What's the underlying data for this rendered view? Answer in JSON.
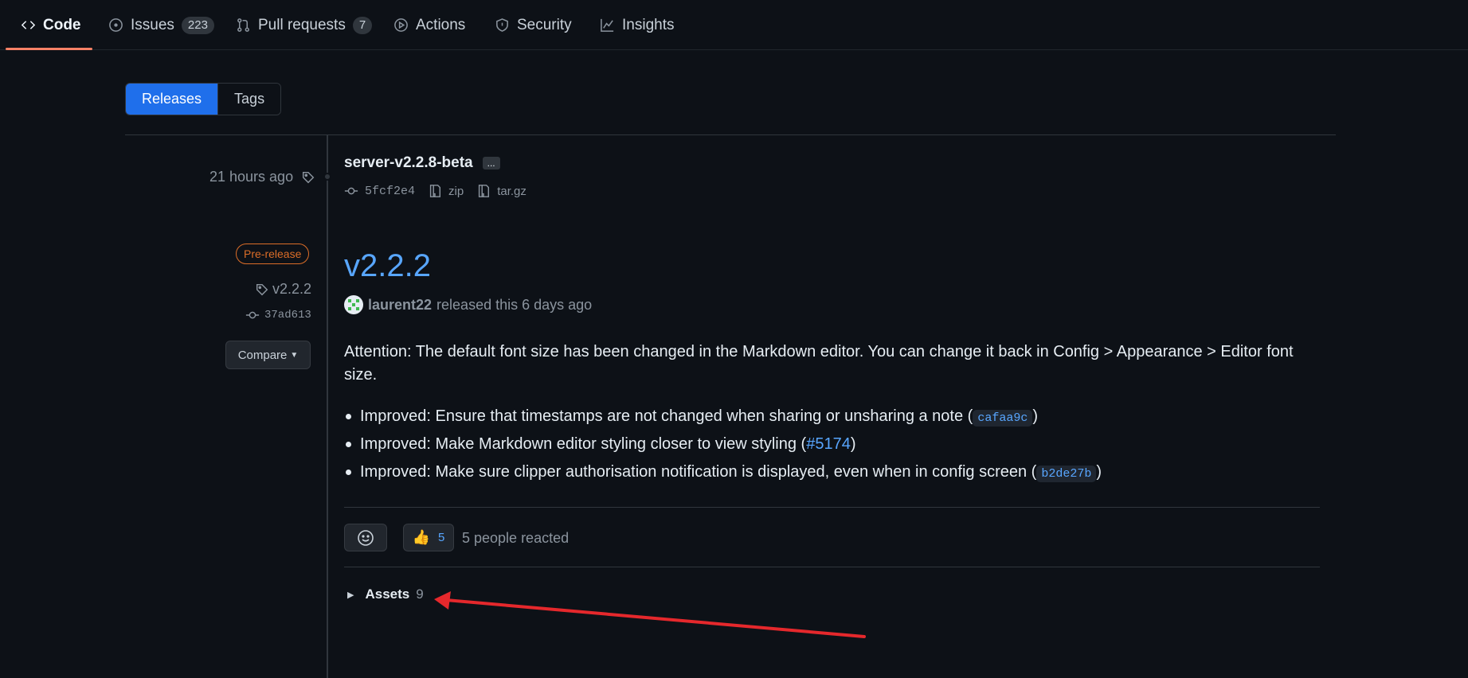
{
  "nav": {
    "tabs": [
      {
        "label": "Code",
        "icon": "code-icon"
      },
      {
        "label": "Issues",
        "count": "223",
        "icon": "issue-icon"
      },
      {
        "label": "Pull requests",
        "count": "7",
        "icon": "pull-request-icon"
      },
      {
        "label": "Actions",
        "icon": "play-icon"
      },
      {
        "label": "Security",
        "icon": "shield-icon"
      },
      {
        "label": "Insights",
        "icon": "graph-icon"
      }
    ]
  },
  "toggle": {
    "releases": "Releases",
    "tags": "Tags"
  },
  "release1": {
    "time": "21 hours ago",
    "title": "server-v2.2.8-beta",
    "more": "...",
    "commit": "5fcf2e4",
    "zip": "zip",
    "targz": "tar.gz"
  },
  "release2": {
    "badge": "Pre-release",
    "tag": "v2.2.2",
    "commit": "37ad613",
    "compare": "Compare",
    "title": "v2.2.2",
    "author": "laurent22",
    "released_text": "released this 6 days ago",
    "attention": "Attention: The default font size has been changed in the Markdown editor. You can change it back in Config > Appearance > Editor font size.",
    "notes": [
      {
        "text": "Improved: Ensure that timestamps are not changed when sharing or unsharing a note (",
        "ref": "cafaa9c",
        "end": ")"
      },
      {
        "text": "Improved: Make Markdown editor styling closer to view styling (",
        "ref": "#5174",
        "end": ")"
      },
      {
        "text": "Improved: Make sure clipper authorisation notification is displayed, even when in config screen (",
        "ref": "b2de27b",
        "end": ")"
      }
    ],
    "reaction_count": "5",
    "reacted_text": "5 people reacted",
    "assets_label": "Assets",
    "assets_count": "9"
  },
  "colors": {
    "accent": "#1f6feb",
    "link": "#58a6ff",
    "prerelease": "#db6d28",
    "annotation_arrow": "#e5282c"
  }
}
